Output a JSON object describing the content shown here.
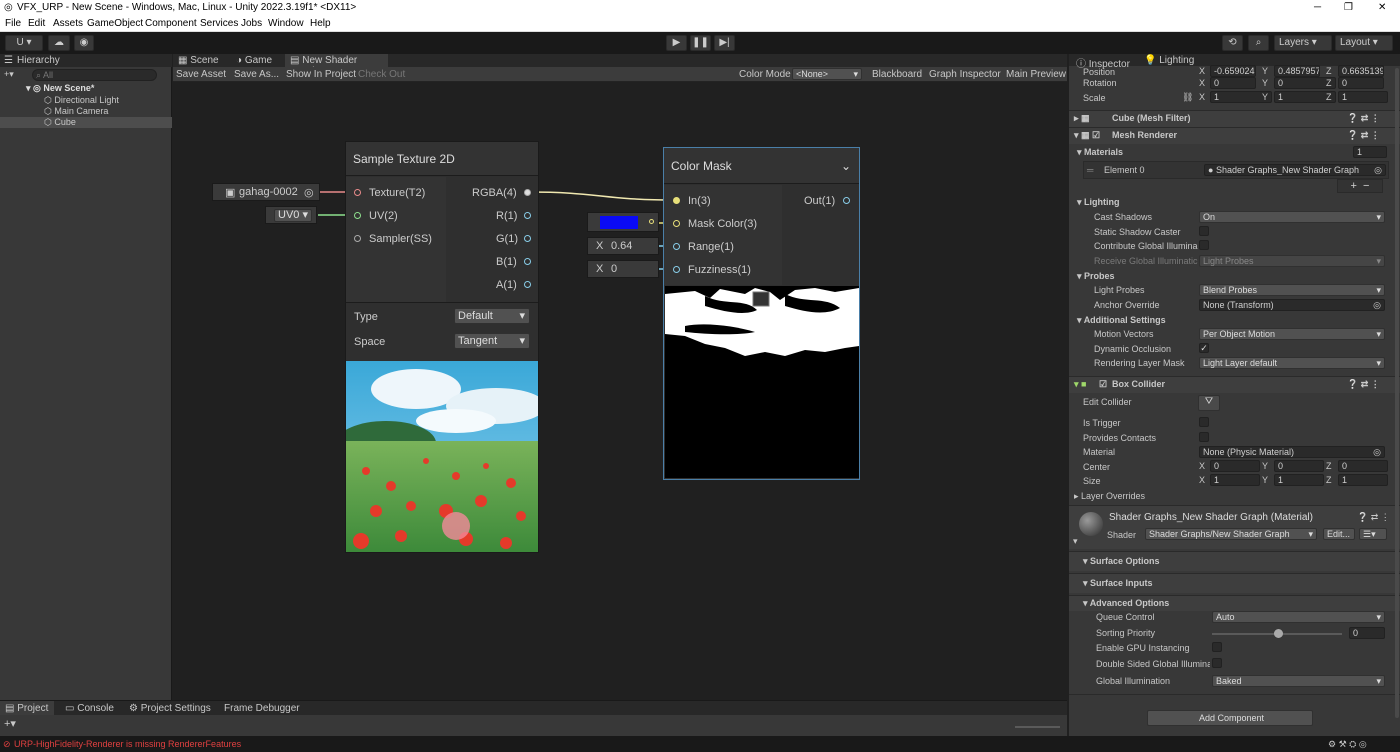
{
  "window": {
    "title": "VFX_URP - New Scene - Windows, Mac, Linux - Unity 2022.3.19f1* <DX11>",
    "min": "─",
    "max": "❐",
    "close": "✕"
  },
  "menu": [
    "File",
    "Edit",
    "Assets",
    "GameObject",
    "Component",
    "Services",
    "Jobs",
    "Window",
    "Help"
  ],
  "toolbar": {
    "account": "U ▾",
    "layers": "Layers",
    "layout": "Layout"
  },
  "hierarchy": {
    "tab": "Hierarchy",
    "search_placeholder": "All",
    "scene": "New Scene*",
    "items": [
      "Directional Light",
      "Main Camera",
      "Cube"
    ]
  },
  "tabs": {
    "scene": "Scene",
    "game": "Game",
    "shader": "New Shader Graph*"
  },
  "sgtoolbar": {
    "save": "Save Asset",
    "saveas": "Save As...",
    "show": "Show In Project",
    "checkout": "Check Out",
    "colormode_label": "Color Mode",
    "colormode": "<None>",
    "blackboard": "Blackboard",
    "graphinspector": "Graph Inspector",
    "mainpreview": "Main Preview"
  },
  "sample": {
    "title": "Sample Texture 2D",
    "tex_in": "gahag-0002",
    "uv_in": "UV0",
    "inputs": [
      "Texture(T2)",
      "UV(2)",
      "Sampler(SS)"
    ],
    "outputs": [
      "RGBA(4)",
      "R(1)",
      "G(1)",
      "B(1)",
      "A(1)"
    ],
    "type_label": "Type",
    "type_val": "Default",
    "space_label": "Space",
    "space_val": "Tangent"
  },
  "colormask": {
    "title": "Color Mask",
    "inputs": [
      "In(3)",
      "Mask Color(3)",
      "Range(1)",
      "Fuzziness(1)"
    ],
    "output": "Out(1)",
    "range_x": "X",
    "range": "0.64",
    "fuzz_x": "X",
    "fuzz": "0",
    "mask_color": "#0a0af5"
  },
  "inspector": {
    "tabs": [
      "Inspector",
      "Lighting"
    ],
    "transform": {
      "position": "Position",
      "pos": [
        "-0.659024",
        "0.4857957",
        "0.6635139"
      ],
      "rotation": "Rotation",
      "rot": [
        "0",
        "0",
        "0"
      ],
      "scale": "Scale",
      "scl": [
        "1",
        "1",
        "1"
      ]
    },
    "meshfilter": "Cube (Mesh Filter)",
    "meshrenderer": "Mesh Renderer",
    "materials": "Materials",
    "mat_count": "1",
    "element0": "Element 0",
    "element0_val": "Shader Graphs_New Shader Graph",
    "lighting": "Lighting",
    "cast_shadows": "Cast Shadows",
    "cast_val": "On",
    "static_caster": "Static Shadow Caster",
    "contrib_gi": "Contribute Global Illumina",
    "receive_gi": "Receive Global Illuminatic",
    "receive_val": "Light Probes",
    "probes": "Probes",
    "light_probes": "Light Probes",
    "light_probes_val": "Blend Probes",
    "anchor": "Anchor Override",
    "anchor_val": "None (Transform)",
    "additional": "Additional Settings",
    "motion": "Motion Vectors",
    "motion_val": "Per Object Motion",
    "dynocc": "Dynamic Occlusion",
    "rlm": "Rendering Layer Mask",
    "rlm_val": "Light Layer default",
    "boxcollider": "Box Collider",
    "edit_collider": "Edit Collider",
    "is_trigger": "Is Trigger",
    "provides": "Provides Contacts",
    "material": "Material",
    "material_val": "None (Physic Material)",
    "center": "Center",
    "center_v": [
      "0",
      "0",
      "0"
    ],
    "size": "Size",
    "size_v": [
      "1",
      "1",
      "1"
    ],
    "layer_overrides": "Layer Overrides",
    "matname": "Shader Graphs_New Shader Graph (Material)",
    "shader_label": "Shader",
    "shader_val": "Shader Graphs/New Shader Graph",
    "edit": "Edit...",
    "surface_options": "Surface Options",
    "surface_inputs": "Surface Inputs",
    "advanced": "Advanced Options",
    "queue": "Queue Control",
    "queue_val": "Auto",
    "sorting": "Sorting Priority",
    "sorting_val": "0",
    "gpu": "Enable GPU Instancing",
    "dsgi": "Double Sided Global Illumina",
    "gi": "Global Illumination",
    "gi_val": "Baked",
    "add_component": "Add Component"
  },
  "bottom": {
    "tabs": [
      "Project",
      "Console",
      "Project Settings",
      "Frame Debugger"
    ]
  },
  "status": {
    "error": "URP-HighFidelity-Renderer is missing RendererFeatures"
  }
}
